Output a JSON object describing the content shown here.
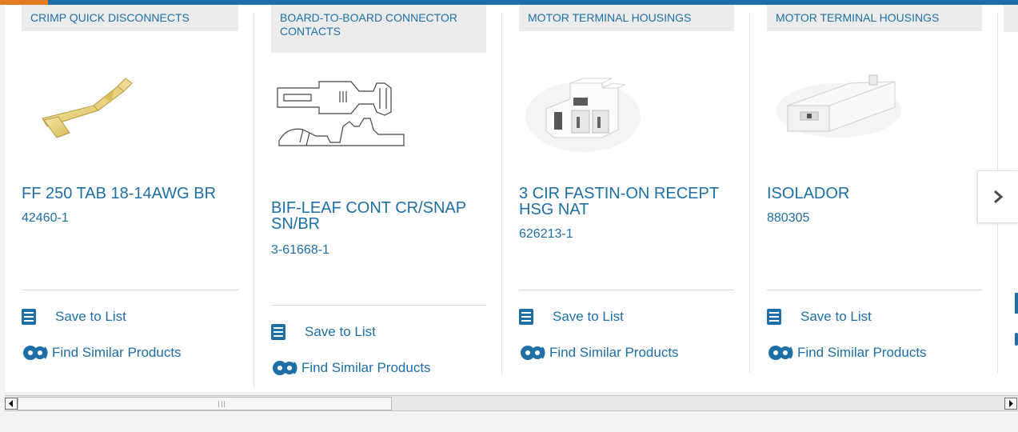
{
  "colors": {
    "brand": "#1d6fa5",
    "accent": "#e67a1f",
    "tag_bg": "#ececec"
  },
  "products": [
    {
      "category": "CRIMP QUICK DISCONNECTS",
      "title": "FF 250 TAB 18-14AWG BR",
      "part_number": "42460-1"
    },
    {
      "category": "BOARD-TO-BOARD CONNECTOR CONTACTS",
      "title": "BIF-LEAF CONT CR/SNAP SN/BR",
      "part_number": "3-61668-1"
    },
    {
      "category": "MOTOR TERMINAL HOUSINGS",
      "title": "3 CIR FASTIN-ON RECEPT HSG NAT",
      "part_number": "626213-1"
    },
    {
      "category": "MOTOR TERMINAL HOUSINGS",
      "title": "ISOLADOR",
      "part_number": "880305"
    }
  ],
  "actions": {
    "save_label": "Save to List",
    "similar_label": "Find Similar Products"
  },
  "icons": {
    "save": "checklist-icon",
    "similar": "gears-icon",
    "next": "chevron-right-icon"
  }
}
